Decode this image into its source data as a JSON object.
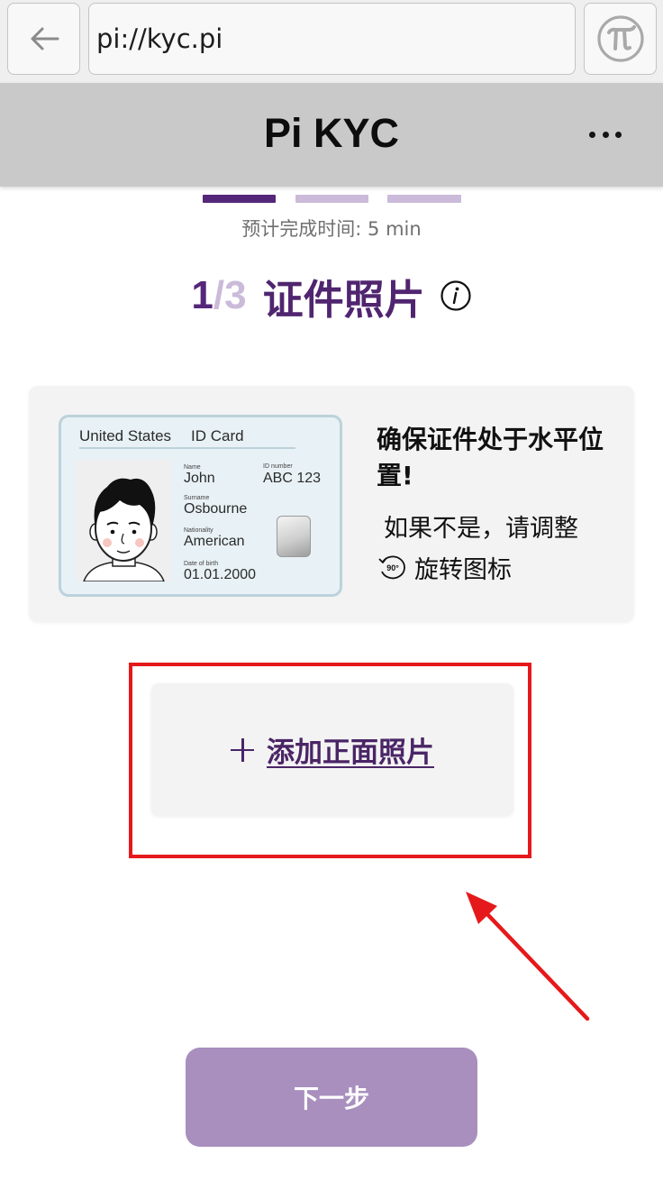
{
  "browser": {
    "back_icon": "arrow-left-icon",
    "url": "pi://kyc.pi",
    "pi_icon": "pi-logo-icon"
  },
  "header": {
    "title": "Pi KYC",
    "more_icon": "more-horizontal-icon"
  },
  "progress": {
    "current_step": 1,
    "total_steps": 3
  },
  "eta": "预计完成时间: 5 min",
  "step": {
    "current": "1",
    "separator": "/",
    "total": "3",
    "title": "证件照片",
    "info_icon": "info-icon"
  },
  "guide": {
    "id_card": {
      "country": "United States",
      "type": "ID Card",
      "name_label": "Name",
      "name": "John",
      "id_label": "ID number",
      "id": "ABC 123",
      "surname_label": "Surname",
      "surname": "Osbourne",
      "nationality_label": "Nationality",
      "nationality": "American",
      "dob_label": "Date of birth",
      "dob": "01.01.2000"
    },
    "heading": "确保证件处于水平位置!",
    "hint_line1": "如果不是，请调整",
    "rotate_badge": "90°",
    "hint_line2": "旋转图标"
  },
  "upload": {
    "plus_icon": "plus-icon",
    "label": "添加正面照片"
  },
  "next_button": {
    "label": "下一步"
  },
  "colors": {
    "accent": "#55277a",
    "accent_light": "#cbbad9",
    "button": "#a88fbe",
    "annotation": "#e5191b"
  }
}
